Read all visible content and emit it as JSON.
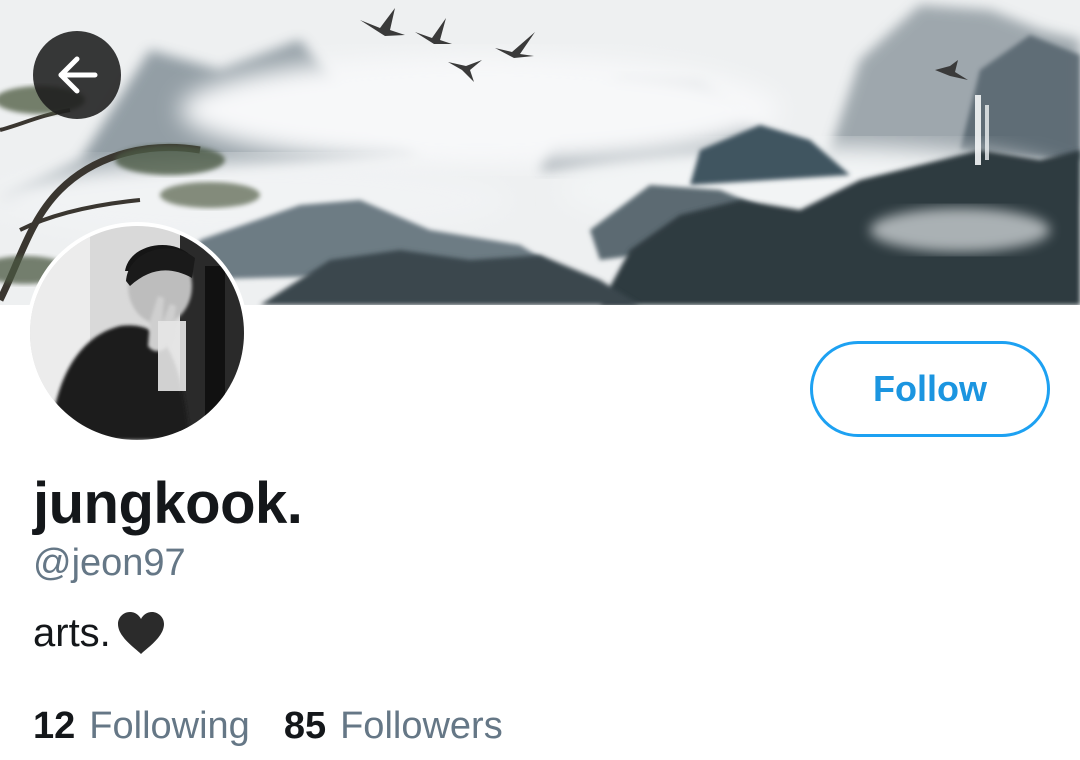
{
  "profile": {
    "display_name": "jungkook.",
    "handle": "@jeon97",
    "bio": "arts.",
    "bio_emoji": "black-heart-icon",
    "following_count": "12",
    "following_label": "Following",
    "followers_count": "85",
    "followers_label": "Followers"
  },
  "actions": {
    "follow_label": "Follow"
  },
  "icons": {
    "back": "back-arrow-icon"
  },
  "colors": {
    "accent": "#1da1f2",
    "text_primary": "#14171a",
    "text_secondary": "#657786"
  }
}
